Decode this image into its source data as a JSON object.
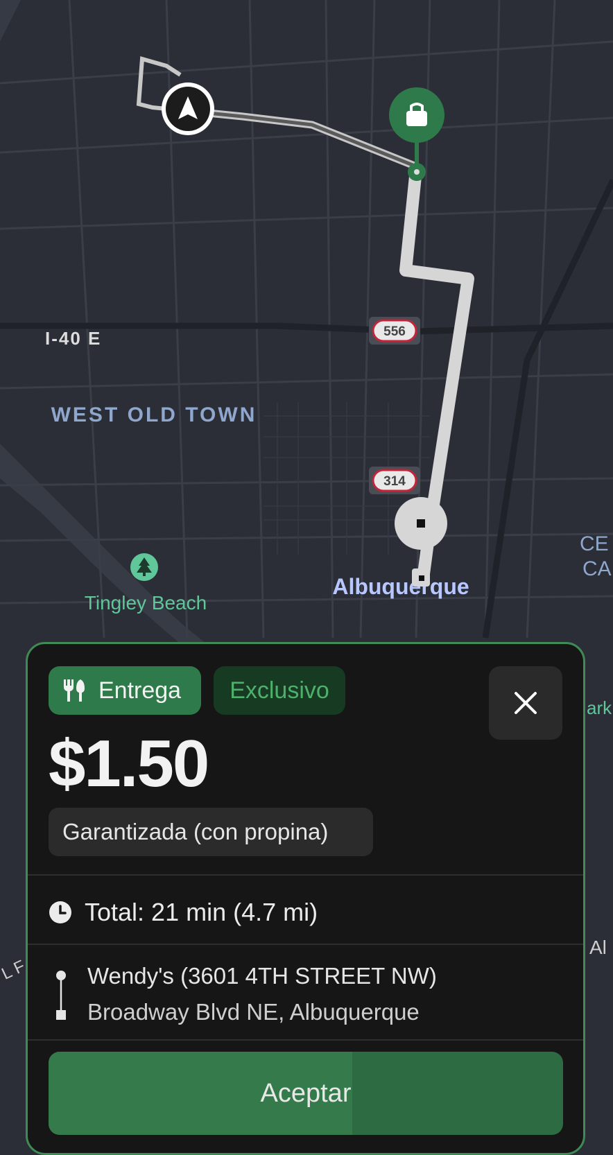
{
  "map": {
    "labels": {
      "freeway": "I-40 E",
      "neighborhood": "WEST OLD TOWN",
      "park": "Tingley Beach",
      "city": "Albuquerque",
      "route_556": "556",
      "route_314": "314",
      "edge_top": "CE",
      "edge_bottom": "CA",
      "edge_park": "ark",
      "edge_right": "Al",
      "edge_left": "L F"
    },
    "icons": {
      "current_location": "navigation-arrow-icon",
      "pickup": "shopping-bag-icon",
      "park": "tree-icon"
    },
    "colors": {
      "route": "#d6d6d6",
      "pickup_pin": "#2f7a4a",
      "background": "#2b2e36"
    }
  },
  "offer": {
    "badges": {
      "delivery": "Entrega",
      "exclusive": "Exclusivo"
    },
    "price": "$1.50",
    "guarantee": "Garantizada (con propina)",
    "total": "Total: 21 min (4.7 mi)",
    "pickup_address": "Wendy's  (3601 4TH STREET NW)",
    "dropoff_address": "Broadway Blvd NE, Albuquerque",
    "accept_label": "Aceptar",
    "accept_progress": 0.59,
    "colors": {
      "accent": "#3f8a55",
      "button": "#2d6b42"
    }
  }
}
